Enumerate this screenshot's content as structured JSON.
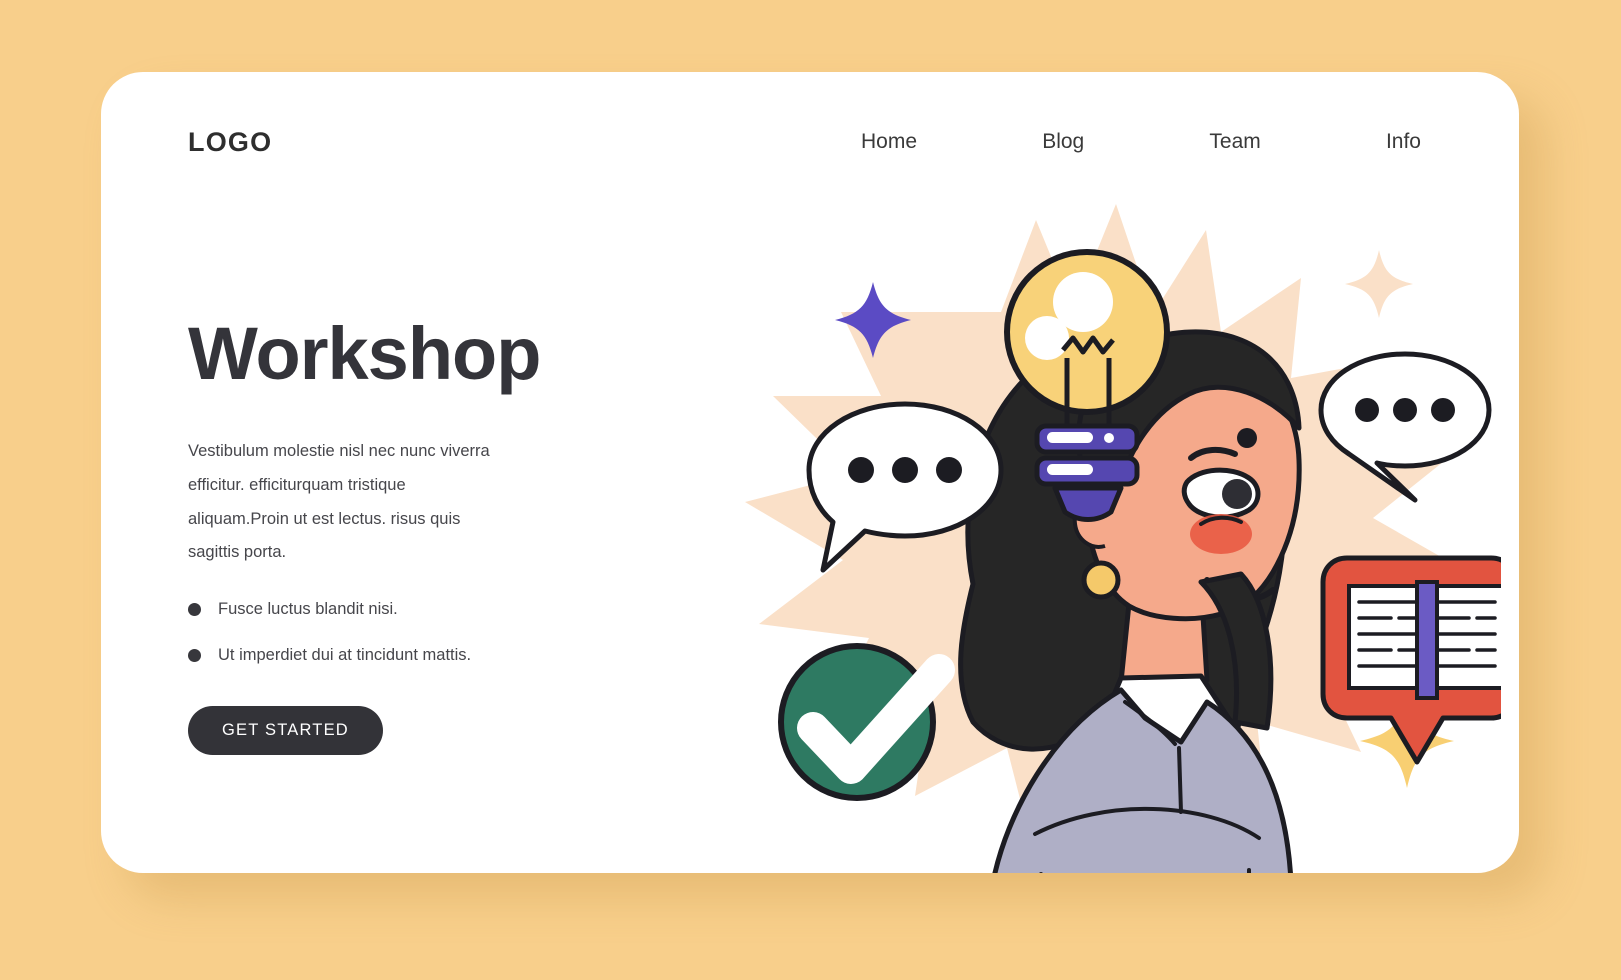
{
  "page": {
    "background_color": "#F8CF8B",
    "card_color": "#FFFFFF"
  },
  "header": {
    "logo": "LOGO",
    "nav": [
      {
        "label": "Home"
      },
      {
        "label": "Blog"
      },
      {
        "label": "Team"
      },
      {
        "label": "Info"
      }
    ]
  },
  "hero": {
    "headline": "Workshop",
    "paragraph": "Vestibulum molestie nisl nec nunc viverra efficitur. efficiturquam tristique aliquam.Proin ut est lectus. risus quis sagittis porta.",
    "bullets": [
      {
        "label": "Fusce luctus blandit nisi."
      },
      {
        "label": "Ut imperdiet dui at tincidunt mattis."
      }
    ],
    "cta_label": "GET STARTED"
  },
  "illustration": {
    "alt": "woman-with-idea-lightbulb",
    "colors": {
      "starburst": "#FAE0C8",
      "hair": "#262626",
      "skin": "#F5A98B",
      "sweater": "#AFAFC6",
      "collar": "#FFFFFF",
      "bulb": "#F8D279",
      "bulb_base": "#5547B0",
      "book_pin": "#E25440",
      "check_circle": "#2E7A62",
      "sparkle_purple": "#5B4BC4",
      "sparkle_yellow": "#F8CF72",
      "sparkle_cream": "#FAE0C8",
      "outline": "#1C1C22"
    },
    "elements": [
      {
        "name": "starburst-background"
      },
      {
        "name": "lightbulb-icon"
      },
      {
        "name": "speech-bubble-left"
      },
      {
        "name": "speech-bubble-right"
      },
      {
        "name": "book-pin-icon"
      },
      {
        "name": "checkmark-badge"
      },
      {
        "name": "sparkle-purple"
      },
      {
        "name": "sparkle-yellow"
      },
      {
        "name": "sparkle-cream"
      },
      {
        "name": "woman-figure"
      }
    ]
  }
}
